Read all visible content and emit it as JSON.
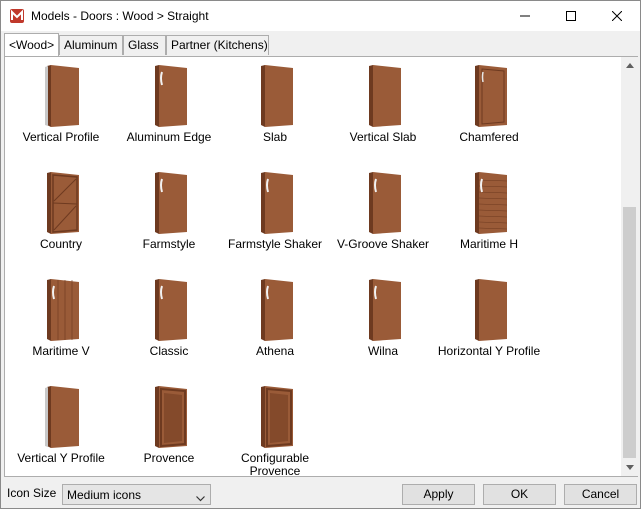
{
  "window": {
    "title": "Models - Doors : Wood > Straight",
    "app_icon": "m-logo-icon",
    "brand_color": "#c0392b"
  },
  "tabs": [
    {
      "label": "<Wood>",
      "active": true
    },
    {
      "label": "Aluminum",
      "active": false
    },
    {
      "label": "Glass",
      "active": false
    },
    {
      "label": "Partner (Kitchens)",
      "active": false
    }
  ],
  "items": [
    {
      "label": "Vertical Profile",
      "door": "profile-edge"
    },
    {
      "label": "Aluminum Edge",
      "door": "handle"
    },
    {
      "label": "Slab",
      "door": "plain"
    },
    {
      "label": "Vertical Slab",
      "door": "plain"
    },
    {
      "label": "Chamfered",
      "door": "chamfered"
    },
    {
      "label": "Country",
      "door": "country"
    },
    {
      "label": "Farmstyle",
      "door": "handle"
    },
    {
      "label": "Farmstyle Shaker",
      "door": "handle"
    },
    {
      "label": "V-Groove Shaker",
      "door": "handle"
    },
    {
      "label": "Maritime H",
      "door": "h-grooves"
    },
    {
      "label": "Maritime V",
      "door": "v-grooves"
    },
    {
      "label": "Classic",
      "door": "handle"
    },
    {
      "label": "Athena",
      "door": "handle"
    },
    {
      "label": "Wilna",
      "door": "handle"
    },
    {
      "label": "Horizontal Y Profile",
      "door": "plain"
    },
    {
      "label": "Vertical Y Profile",
      "door": "profile-edge"
    },
    {
      "label": "Provence",
      "door": "frame"
    },
    {
      "label": "Configurable\nProvence",
      "door": "frame"
    }
  ],
  "footer": {
    "icon_size_label": "Icon Size",
    "icon_size_value": "Medium icons",
    "apply_label": "Apply",
    "ok_label": "OK",
    "cancel_label": "Cancel"
  },
  "colors": {
    "wood_light": "#9a5b38",
    "wood_dark": "#6e3a20",
    "wood_mid": "#844a2b"
  }
}
